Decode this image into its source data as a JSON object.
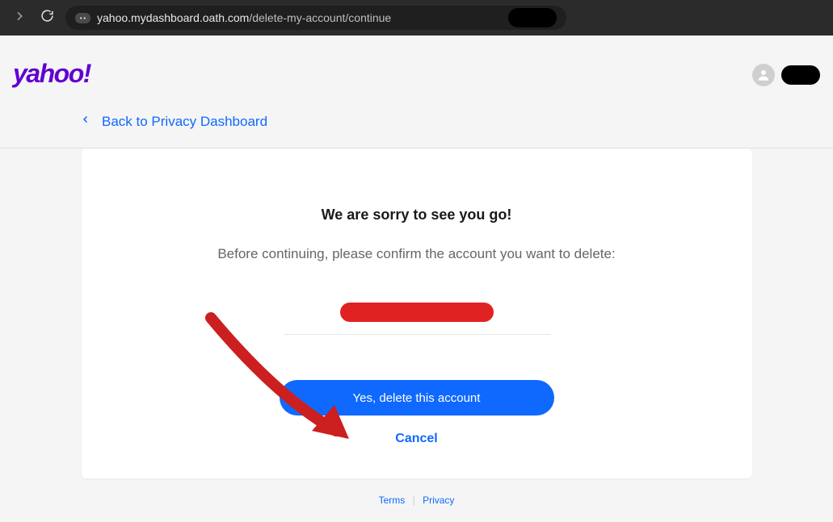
{
  "browser": {
    "url_domain": "yahoo.mydashboard.oath.com",
    "url_path": "/delete-my-account/continue"
  },
  "header": {
    "logo_text": "yahoo!",
    "back_link": "Back to Privacy Dashboard"
  },
  "card": {
    "title": "We are sorry to see you go!",
    "subtitle": "Before continuing, please confirm the account you want to delete:",
    "confirm_button": "Yes, delete this account",
    "cancel_button": "Cancel"
  },
  "footer": {
    "terms": "Terms",
    "privacy": "Privacy",
    "separator": "|"
  }
}
